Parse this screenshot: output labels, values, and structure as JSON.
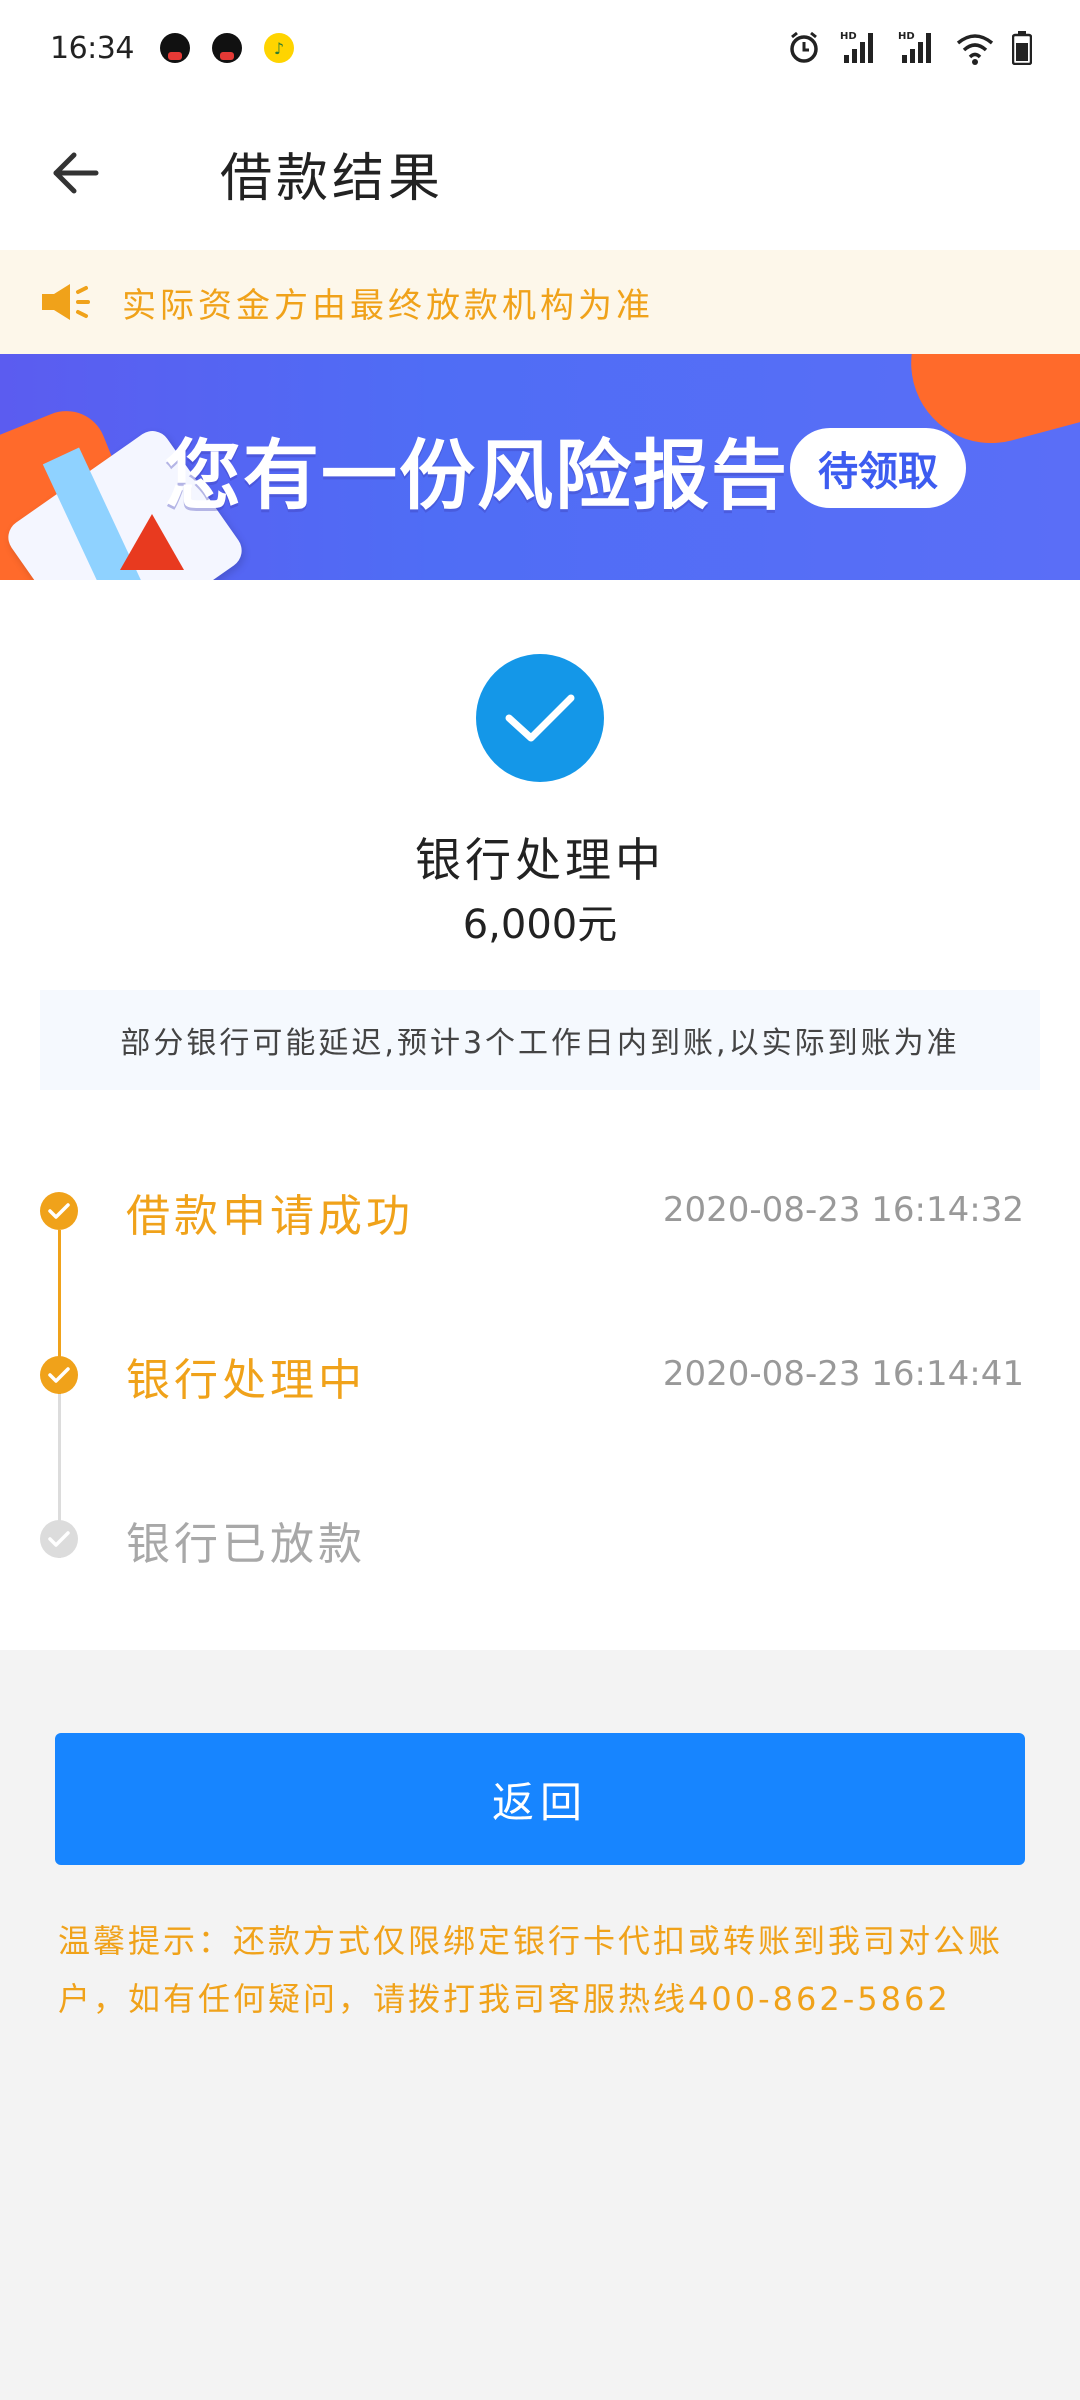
{
  "status_bar": {
    "time": "16:34",
    "notification_icons": [
      "qq-icon",
      "qq-icon",
      "music-icon"
    ],
    "system_icons": [
      "alarm-icon",
      "hd-signal-icon",
      "hd-signal-icon",
      "wifi-icon",
      "battery-icon"
    ],
    "hd_label": "HD"
  },
  "header": {
    "title": "借款结果",
    "back_icon": "back-arrow-icon"
  },
  "notice": {
    "icon": "speaker-icon",
    "text": "实际资金方由最终放款机构为准"
  },
  "banner": {
    "title": "您有一份风险报告",
    "pill": "待领取"
  },
  "result": {
    "icon": "check-circle-icon",
    "status": "银行处理中",
    "amount": "6,000元",
    "info": "部分银行可能延迟,预计3个工作日内到账,以实际到账为准"
  },
  "timeline": [
    {
      "label": "借款申请成功",
      "time": "2020-08-23 16:14:32",
      "state": "done"
    },
    {
      "label": "银行处理中",
      "time": "2020-08-23 16:14:41",
      "state": "done"
    },
    {
      "label": "银行已放款",
      "time": "",
      "state": "todo"
    }
  ],
  "actions": {
    "return_label": "返回"
  },
  "tips": {
    "text": "温馨提示：还款方式仅限绑定银行卡代扣或转账到我司对公账户，如有任何疑问，请拨打我司客服热线400-862-5862"
  },
  "colors": {
    "accent_orange": "#f0a21a",
    "primary_blue": "#1785ff",
    "check_blue": "#1497e8",
    "notice_bg": "#fdf7ea",
    "pending_gray": "#dcdcdc"
  }
}
